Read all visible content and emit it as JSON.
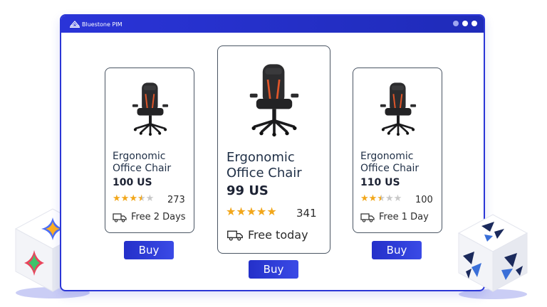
{
  "window": {
    "brand": "Bluestone PIM"
  },
  "products": [
    {
      "name": "Ergonomic\nOffice Chair",
      "price": "100 US",
      "rating": 3.5,
      "reviews": "273",
      "shipping": "Free 2 Days",
      "buy_label": "Buy"
    },
    {
      "name": "Ergonomic\nOffice Chair",
      "price": "99 US",
      "rating": 5,
      "reviews": "341",
      "shipping": "Free today",
      "buy_label": "Buy"
    },
    {
      "name": "Ergonomic\nOffice Chair",
      "price": "110 US",
      "rating": 2.5,
      "reviews": "100",
      "shipping": "Free 1 Day",
      "buy_label": "Buy"
    }
  ],
  "colors": {
    "accent": "#2b36d6",
    "star": "#f2a71b",
    "star_empty": "#c8c8c8",
    "chair_trim": "#e0562a"
  },
  "icons": [
    "bluestone-logo-icon",
    "window-dot-icon",
    "chair-image",
    "star-icon",
    "delivery-truck-icon",
    "cube-logo-icon"
  ]
}
